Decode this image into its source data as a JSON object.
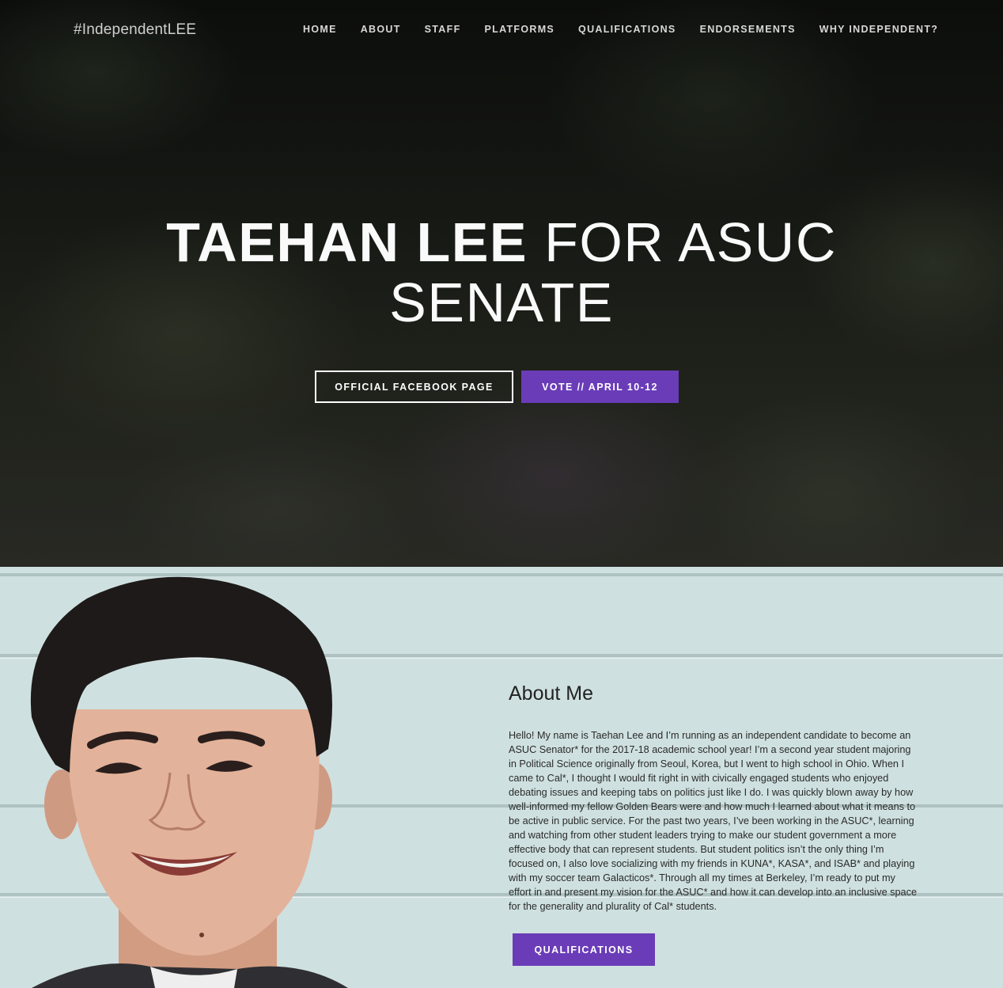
{
  "brand": "#IndependentLEE",
  "nav": [
    "HOME",
    "ABOUT",
    "STAFF",
    "PLATFORMS",
    "QUALIFICATIONS",
    "ENDORSEMENTS",
    "WHY INDEPENDENT?"
  ],
  "hero": {
    "name": "TAEHAN LEE",
    "title_rest": " FOR ASUC",
    "title_line2": "SENATE",
    "facebook_button": "OFFICIAL FACEBOOK PAGE",
    "vote_button": "VOTE // APRIL 10-12"
  },
  "about": {
    "title": "About Me",
    "body": "Hello! My name is Taehan Lee and I’m running as an independent candidate to become an ASUC Senator* for the 2017-18 academic school year! I’m a second year student majoring in Political Science originally from Seoul, Korea, but I went to high school in Ohio. When I came to Cal*, I thought I would fit right in with civically engaged students who enjoyed debating issues and keeping tabs on politics just like I do. I was quickly blown away by how well-informed my fellow Golden Bears were and how much I learned about what it means to be active in public service. For the past two years, I’ve been working in the ASUC*, learning and watching from other student leaders trying to make our student government a more effective body that can represent students. But student politics isn’t the only thing I’m focused on, I also love socializing with my friends in KUNA*, KASA*, and ISAB* and playing with my soccer team Galacticos*. Through all my times at Berkeley, I’m ready to put my effort in and present my vision for the ASUC* and how it can develop into an inclusive space for the generality and plurality of Cal* students.",
    "qualifications_button": "QUALIFICATIONS"
  },
  "colors": {
    "accent": "#6a3cb8",
    "about_bg": "#cfe0e0"
  }
}
